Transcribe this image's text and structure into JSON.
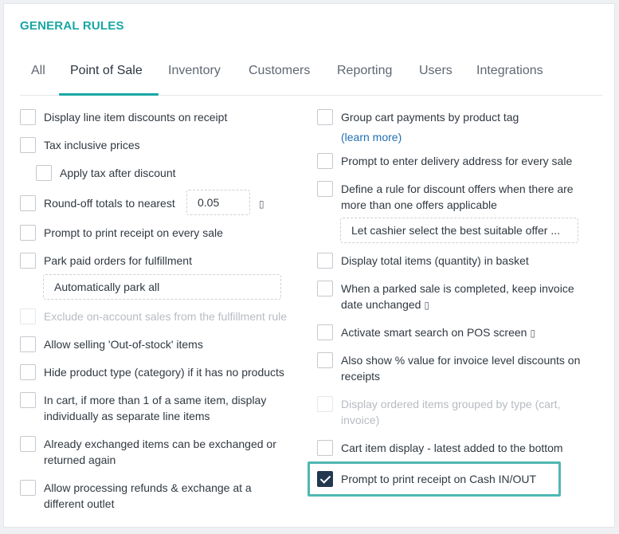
{
  "header": {
    "title": "GENERAL RULES"
  },
  "tabs": [
    {
      "label": "All"
    },
    {
      "label": "Point of Sale"
    },
    {
      "label": "Inventory"
    },
    {
      "label": "Customers"
    },
    {
      "label": "Reporting"
    },
    {
      "label": "Users"
    },
    {
      "label": "Integrations"
    }
  ],
  "active_tab": "Point of Sale",
  "left": {
    "display_discounts": "Display line item discounts on receipt",
    "tax_inclusive": "Tax inclusive prices",
    "apply_tax_after_discount": "Apply tax after discount",
    "round_off": "Round-off totals to nearest",
    "round_off_value": "0.05",
    "info_glyph": "▯",
    "prompt_print_receipt": "Prompt to print receipt on every sale",
    "park_paid_orders": "Park paid orders for fulfillment",
    "park_select_value": "Automatically park all",
    "exclude_on_account": "Exclude on-account sales from the fulfillment rule",
    "allow_out_of_stock": "Allow selling 'Out-of-stock' items",
    "hide_product_type": "Hide product type (category) if it has no products",
    "cart_separate_line_1": "In cart, if more than 1 of a same item, display",
    "cart_separate_line_2": "individually as separate line items",
    "exchanged_again_1": "Already exchanged items can be exchanged or",
    "exchanged_again_2": "returned again",
    "refunds_outlet_1": "Allow processing refunds & exchange at a",
    "refunds_outlet_2": "different outlet"
  },
  "right": {
    "group_cart_payments": "Group cart payments by product tag",
    "learn_more": "(learn more)",
    "delivery_address": "Prompt to enter delivery address for every sale",
    "discount_rule_1": "Define a rule for discount offers when there are",
    "discount_rule_2": "more than one offers applicable",
    "discount_rule_select": "Let cashier select the best suitable offer ...",
    "total_items": "Display total items (quantity) in basket",
    "parked_sale_1": "When a parked sale is completed, keep invoice",
    "parked_sale_2": "date unchanged",
    "smart_search": "Activate smart search on POS screen",
    "percent_value_1": "Also show % value for invoice level discounts on",
    "percent_value_2": "receipts",
    "grouped_by_type_1": "Display ordered items grouped by type (cart,",
    "grouped_by_type_2": "invoice)",
    "cart_item_display": "Cart item display - latest added to the bottom",
    "cash_in_out": "Prompt to print receipt on Cash IN/OUT"
  },
  "checkbox_states": {
    "cash_in_out": true
  },
  "colors": {
    "accent": "#17a7a4",
    "checked": "#22384f",
    "link": "#1f6fb2",
    "highlight": "#4fb7b3"
  }
}
